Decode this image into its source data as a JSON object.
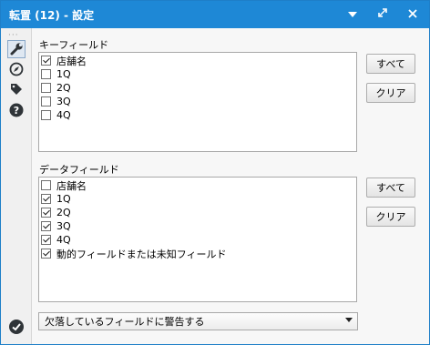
{
  "window": {
    "title": "転置 (12) - 設定",
    "title_bg": "#1e88d6"
  },
  "titlebar_buttons": [
    "chevron-down-icon",
    "restore-icon",
    "close-icon"
  ],
  "sidebar": {
    "icons": [
      "wrench-icon",
      "navigator-icon",
      "tag-icon",
      "help-icon"
    ],
    "bottom_icon": "checkmark-icon"
  },
  "key_fields": {
    "label": "キーフィールド",
    "items": [
      {
        "label": "店舗名",
        "checked": true
      },
      {
        "label": "1Q",
        "checked": false
      },
      {
        "label": "2Q",
        "checked": false
      },
      {
        "label": "3Q",
        "checked": false
      },
      {
        "label": "4Q",
        "checked": false
      }
    ],
    "select_all_label": "すべて",
    "clear_label": "クリア"
  },
  "data_fields": {
    "label": "データフィールド",
    "items": [
      {
        "label": "店舗名",
        "checked": false
      },
      {
        "label": "1Q",
        "checked": true
      },
      {
        "label": "2Q",
        "checked": true
      },
      {
        "label": "3Q",
        "checked": true
      },
      {
        "label": "4Q",
        "checked": true
      },
      {
        "label": "動的フィールドまたは未知フィールド",
        "checked": true
      }
    ],
    "select_all_label": "すべて",
    "clear_label": "クリア"
  },
  "missing_field_option": {
    "selected": "欠落しているフィールドに警告する"
  }
}
